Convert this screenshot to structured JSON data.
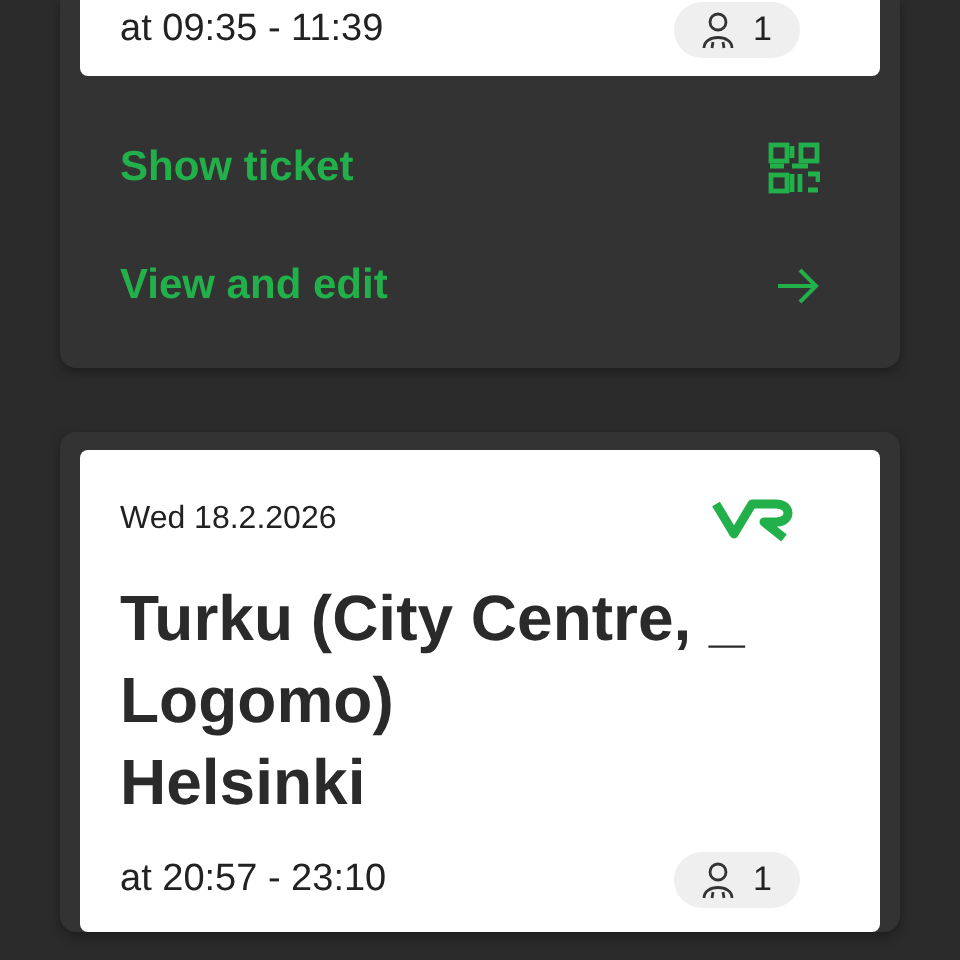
{
  "trips": [
    {
      "time": "at 09:35 - 11:39",
      "passengers": "1",
      "actions": [
        {
          "label": "Show ticket",
          "kind": "qr"
        },
        {
          "label": "View and edit",
          "kind": "arrow"
        }
      ]
    },
    {
      "date": "Wed 18.2.2026",
      "route": [
        "Turku (City Centre, _",
        "Logomo)",
        "Helsinki"
      ],
      "time": "at 20:57 - 23:10",
      "passengers": "1"
    }
  ]
}
